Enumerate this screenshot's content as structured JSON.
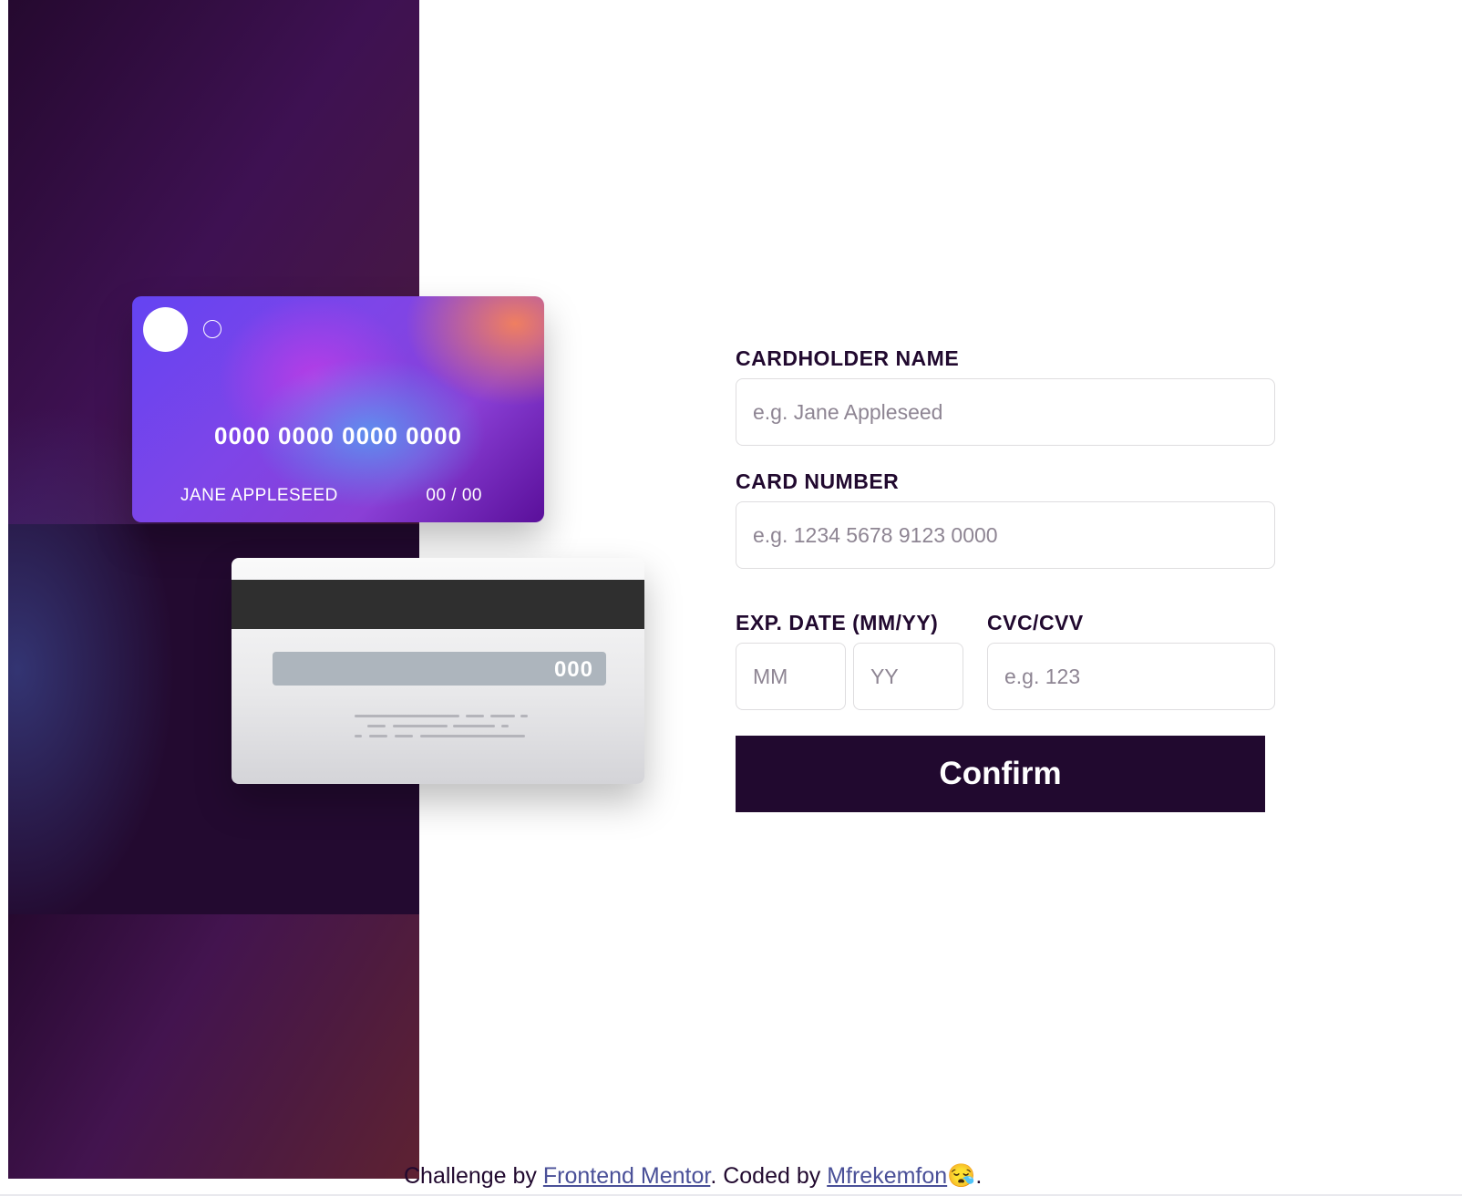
{
  "card_front": {
    "number": "0000 0000 0000 0000",
    "name": "JANE APPLESEED",
    "expiry": "00 / 00"
  },
  "card_back": {
    "cvc": "000"
  },
  "form": {
    "cardholder_label": "CARDHOLDER NAME",
    "cardholder_placeholder": "e.g. Jane Appleseed",
    "number_label": "CARD NUMBER",
    "number_placeholder": "e.g. 1234 5678 9123 0000",
    "exp_label": "EXP. DATE (MM/YY)",
    "month_placeholder": "MM",
    "year_placeholder": "YY",
    "cvc_label": "CVC/CVV",
    "cvc_placeholder": "e.g. 123",
    "confirm_label": "Confirm"
  },
  "footer": {
    "prefix": "Challenge by ",
    "link1": "Frontend Mentor",
    "middle": ". Coded by ",
    "link2": "Mfrekemfon",
    "emoji": "😪",
    "suffix": "."
  },
  "colors": {
    "dark_violet": "#21092f",
    "link": "#4a5098",
    "input_border": "#dedddf"
  }
}
